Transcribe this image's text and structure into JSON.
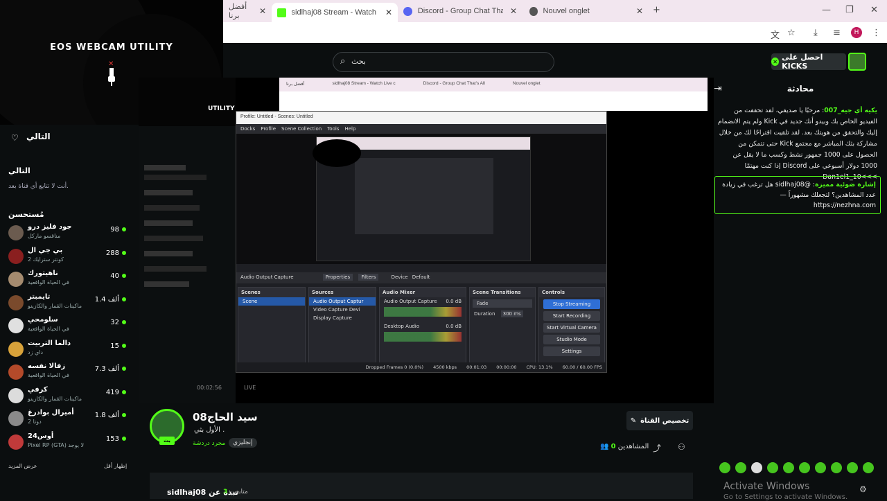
{
  "browser": {
    "tabs": [
      {
        "label": "أفضل برنا",
        "favicon_color": "#e8e8e8"
      },
      {
        "label": "sidlhaj08 Stream - Watch Live c",
        "favicon_color": "#53fc18",
        "active": true
      },
      {
        "label": "Discord - Group Chat That's All",
        "favicon_color": "#5865f2"
      },
      {
        "label": "Nouvel onglet",
        "favicon_color": "#555555"
      }
    ],
    "new_tab": "+",
    "profile_initial": "H"
  },
  "header": {
    "search_placeholder": "بحث",
    "kicks_button": "احصل على KICKS"
  },
  "webcam": {
    "title": "EOS WEBCAM UTILITY"
  },
  "sidebar": {
    "following_title": "التالي",
    "following_section": "التالي",
    "following_empty": "أنت لا تتابع أي قناة بعد.",
    "recommended_title": "مُستحسن",
    "channels": [
      {
        "name": "جود فليز درو",
        "game": "مناقسو ماركل",
        "count": "98",
        "color": "#6b5b4f"
      },
      {
        "name": "بي جي ال",
        "game": "كونتر سترايك 2",
        "count": "288",
        "color": "#8a1f1f"
      },
      {
        "name": "ناهيتورك",
        "game": "في الحياة الواقعية",
        "count": "40",
        "color": "#a58b6f"
      },
      {
        "name": "تايمبتر",
        "game": "ماكينات القمار والكازينو",
        "count": "1.4 ألف",
        "color": "#7a4a2c"
      },
      {
        "name": "سلومحي",
        "game": "في الحياة الواقعية",
        "count": "32",
        "color": "#e0e0e0"
      },
      {
        "name": "دالما التربيت",
        "game": "داي زد",
        "count": "15",
        "color": "#d8a23a"
      },
      {
        "name": "زفالا نفسه",
        "game": "في الحياة الواقعية",
        "count": "7.3 ألف",
        "color": "#b44a2a"
      },
      {
        "name": "كرفي",
        "game": "ماكينات القمار والكازينو",
        "count": "419",
        "color": "#dcdcdc"
      },
      {
        "name": "أميرال بوادرغ",
        "game": "دوتا 2",
        "count": "1.8 ألف",
        "color": "#8a8a8a"
      },
      {
        "name": "أوس24",
        "game": "Pixel RP (GTA) لا يوجد",
        "count": "153",
        "color": "#c03a3a"
      }
    ],
    "show_less": "إظهار أقل",
    "show_more": "عرض المزيد"
  },
  "obs": {
    "title": "Profile: Untitled - Scenes: Untitled",
    "menu": [
      "Docks",
      "Profile",
      "Scene Collection",
      "Tools",
      "Help"
    ],
    "source_label": "Audio Output Capture",
    "properties": "Properties",
    "filters": "Filters",
    "device_label": "Device",
    "device_value": "Default",
    "scenes_title": "Scenes",
    "scene_item": "Scene",
    "sources_title": "Sources",
    "sources": [
      "Audio Output Captur",
      "Video Capture Devi",
      "Display Capture"
    ],
    "mixer_title": "Audio Mixer",
    "mixer_tracks": [
      {
        "name": "Audio Output Capture",
        "db": "0.0 dB"
      },
      {
        "name": "Desktop Audio",
        "db": "0.0 dB"
      }
    ],
    "transitions_title": "Scene Transitions",
    "transition_value": "Fade",
    "duration_label": "Duration",
    "duration_value": "300 ms",
    "controls_title": "Controls",
    "controls": [
      "Stop Streaming",
      "Start Recording",
      "Start Virtual Camera",
      "Studio Mode",
      "Settings"
    ],
    "status": [
      "Dropped Frames 0 (0.0%)",
      "4500 kbps",
      "00:01:03",
      "00:00:00",
      "CPU: 13.1%",
      "60.00 / 60.00 FPS"
    ]
  },
  "stream": {
    "streamer": "سيد الحاج08",
    "live_badge": "بث",
    "title": "الأول بثي .",
    "category": "مجرد دردشة",
    "tag": "إنجليزي",
    "customize": "تخصيص القناة",
    "viewers_label": "المشاهدين",
    "viewers_count": "0",
    "bottom_name": "sidlhaj08 نبذة عن",
    "followers_count": "3",
    "followers_label": "متابعين",
    "video_live": "LIVE",
    "video_time": "00:02:56"
  },
  "chat": {
    "title": "محادثة",
    "message1_user": "يكيه أي جيه_007",
    "message1_text": "مرحبًا يا صديقي، لقد تحققت من الفيديو الخاص بك وبيدو أنك جديد في Kick ولم يتم الانضمام إليك والتحقق من هويتك بعد. لقد تلقيت اقتراحًا لك من خلال مشاركة بثك المباشر مع مجتمع Kick حتى تتمكن من الحصول على 1000 جمهور نشط وكسب ما لا يقل عن 1000 دولار أسبوعي على Discord إذا كنت مهتمًا >>>Dan1el1_10",
    "message2_user": "إشارة ضوئية مميزة",
    "message2_mention": "@sidlhaj08",
    "message2_text": "هل ترغب في زيادة عدد المشاهدين؟ لتجعلك مشهوراً — https://nezhna.com",
    "watermark": "Activate Windows",
    "watermark_sub": "Go to Settings to activate Windows."
  }
}
